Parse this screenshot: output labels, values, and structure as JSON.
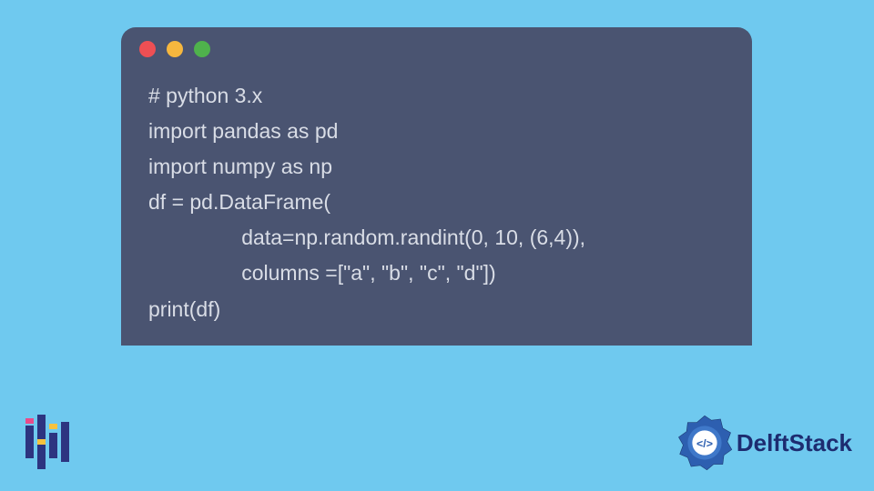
{
  "code": {
    "lines": [
      "# python 3.x",
      "import pandas as pd",
      "import numpy as np",
      "df = pd.DataFrame(",
      "                data=np.random.randint(0, 10, (6,4)),",
      "                columns =[\"a\", \"b\", \"c\", \"d\"])",
      "print(df)"
    ]
  },
  "window": {
    "dots": [
      "red",
      "yellow",
      "green"
    ]
  },
  "brand": {
    "name": "DelftStack"
  }
}
